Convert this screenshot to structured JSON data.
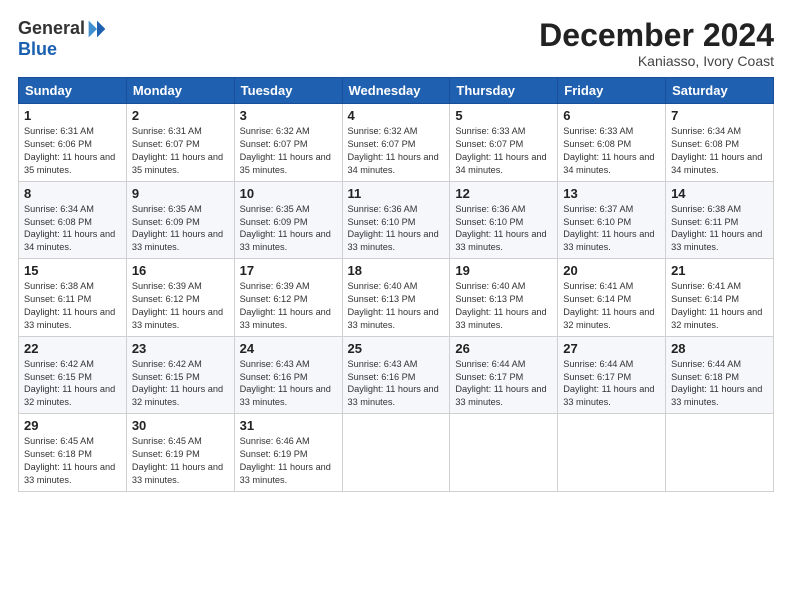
{
  "logo": {
    "general": "General",
    "blue": "Blue"
  },
  "title": {
    "month": "December 2024",
    "location": "Kaniasso, Ivory Coast"
  },
  "weekdays": [
    "Sunday",
    "Monday",
    "Tuesday",
    "Wednesday",
    "Thursday",
    "Friday",
    "Saturday"
  ],
  "weeks": [
    [
      {
        "day": "1",
        "sunrise": "6:31 AM",
        "sunset": "6:06 PM",
        "daylight": "11 hours and 35 minutes."
      },
      {
        "day": "2",
        "sunrise": "6:31 AM",
        "sunset": "6:07 PM",
        "daylight": "11 hours and 35 minutes."
      },
      {
        "day": "3",
        "sunrise": "6:32 AM",
        "sunset": "6:07 PM",
        "daylight": "11 hours and 35 minutes."
      },
      {
        "day": "4",
        "sunrise": "6:32 AM",
        "sunset": "6:07 PM",
        "daylight": "11 hours and 34 minutes."
      },
      {
        "day": "5",
        "sunrise": "6:33 AM",
        "sunset": "6:07 PM",
        "daylight": "11 hours and 34 minutes."
      },
      {
        "day": "6",
        "sunrise": "6:33 AM",
        "sunset": "6:08 PM",
        "daylight": "11 hours and 34 minutes."
      },
      {
        "day": "7",
        "sunrise": "6:34 AM",
        "sunset": "6:08 PM",
        "daylight": "11 hours and 34 minutes."
      }
    ],
    [
      {
        "day": "8",
        "sunrise": "6:34 AM",
        "sunset": "6:08 PM",
        "daylight": "11 hours and 34 minutes."
      },
      {
        "day": "9",
        "sunrise": "6:35 AM",
        "sunset": "6:09 PM",
        "daylight": "11 hours and 33 minutes."
      },
      {
        "day": "10",
        "sunrise": "6:35 AM",
        "sunset": "6:09 PM",
        "daylight": "11 hours and 33 minutes."
      },
      {
        "day": "11",
        "sunrise": "6:36 AM",
        "sunset": "6:10 PM",
        "daylight": "11 hours and 33 minutes."
      },
      {
        "day": "12",
        "sunrise": "6:36 AM",
        "sunset": "6:10 PM",
        "daylight": "11 hours and 33 minutes."
      },
      {
        "day": "13",
        "sunrise": "6:37 AM",
        "sunset": "6:10 PM",
        "daylight": "11 hours and 33 minutes."
      },
      {
        "day": "14",
        "sunrise": "6:38 AM",
        "sunset": "6:11 PM",
        "daylight": "11 hours and 33 minutes."
      }
    ],
    [
      {
        "day": "15",
        "sunrise": "6:38 AM",
        "sunset": "6:11 PM",
        "daylight": "11 hours and 33 minutes."
      },
      {
        "day": "16",
        "sunrise": "6:39 AM",
        "sunset": "6:12 PM",
        "daylight": "11 hours and 33 minutes."
      },
      {
        "day": "17",
        "sunrise": "6:39 AM",
        "sunset": "6:12 PM",
        "daylight": "11 hours and 33 minutes."
      },
      {
        "day": "18",
        "sunrise": "6:40 AM",
        "sunset": "6:13 PM",
        "daylight": "11 hours and 33 minutes."
      },
      {
        "day": "19",
        "sunrise": "6:40 AM",
        "sunset": "6:13 PM",
        "daylight": "11 hours and 33 minutes."
      },
      {
        "day": "20",
        "sunrise": "6:41 AM",
        "sunset": "6:14 PM",
        "daylight": "11 hours and 32 minutes."
      },
      {
        "day": "21",
        "sunrise": "6:41 AM",
        "sunset": "6:14 PM",
        "daylight": "11 hours and 32 minutes."
      }
    ],
    [
      {
        "day": "22",
        "sunrise": "6:42 AM",
        "sunset": "6:15 PM",
        "daylight": "11 hours and 32 minutes."
      },
      {
        "day": "23",
        "sunrise": "6:42 AM",
        "sunset": "6:15 PM",
        "daylight": "11 hours and 32 minutes."
      },
      {
        "day": "24",
        "sunrise": "6:43 AM",
        "sunset": "6:16 PM",
        "daylight": "11 hours and 33 minutes."
      },
      {
        "day": "25",
        "sunrise": "6:43 AM",
        "sunset": "6:16 PM",
        "daylight": "11 hours and 33 minutes."
      },
      {
        "day": "26",
        "sunrise": "6:44 AM",
        "sunset": "6:17 PM",
        "daylight": "11 hours and 33 minutes."
      },
      {
        "day": "27",
        "sunrise": "6:44 AM",
        "sunset": "6:17 PM",
        "daylight": "11 hours and 33 minutes."
      },
      {
        "day": "28",
        "sunrise": "6:44 AM",
        "sunset": "6:18 PM",
        "daylight": "11 hours and 33 minutes."
      }
    ],
    [
      {
        "day": "29",
        "sunrise": "6:45 AM",
        "sunset": "6:18 PM",
        "daylight": "11 hours and 33 minutes."
      },
      {
        "day": "30",
        "sunrise": "6:45 AM",
        "sunset": "6:19 PM",
        "daylight": "11 hours and 33 minutes."
      },
      {
        "day": "31",
        "sunrise": "6:46 AM",
        "sunset": "6:19 PM",
        "daylight": "11 hours and 33 minutes."
      },
      null,
      null,
      null,
      null
    ]
  ]
}
